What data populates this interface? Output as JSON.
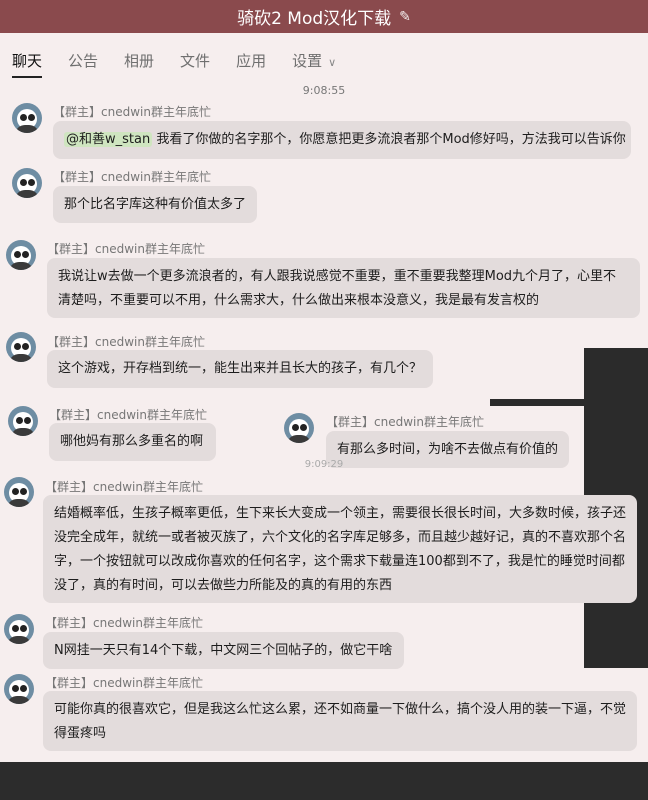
{
  "window": {
    "title": "骑砍2 Mod汉化下载",
    "edit_icon": "✎"
  },
  "tabs": [
    {
      "label": "聊天"
    },
    {
      "label": "公告"
    },
    {
      "label": "相册"
    },
    {
      "label": "文件"
    },
    {
      "label": "应用"
    },
    {
      "label": "设置"
    }
  ],
  "timestamps": {
    "t1": "9:08:55",
    "t2": "9:09:29"
  },
  "messages": [
    {
      "sender": "【群主】cnedwin群主年底忙",
      "mention": "@和善w_stan",
      "text": "我看了你做的名字那个，你愿意把更多流浪者那个Mod修好吗，方法我可以告诉你"
    },
    {
      "sender": "【群主】cnedwin群主年底忙",
      "text": "那个比名字库这种有价值太多了"
    },
    {
      "sender": "【群主】cnedwin群主年底忙",
      "text": "我说让w去做一个更多流浪者的，有人跟我说感觉不重要，重不重要我整理Mod九个月了，心里不清楚吗，不重要可以不用，什么需求大，什么做出来根本没意义，我是最有发言权的"
    },
    {
      "sender": "【群主】cnedwin群主年底忙",
      "text": "这个游戏，开存档到统一，能生出来并且长大的孩子，有几个？"
    },
    {
      "sender": "【群主】cnedwin群主年底忙",
      "text": "哪他妈有那么多重名的啊"
    },
    {
      "sender": "【群主】cnedwin群主年底忙",
      "text": "有那么多时间，为啥不去做点有价值的"
    },
    {
      "sender": "【群主】cnedwin群主年底忙",
      "text": "结婚概率低，生孩子概率更低，生下来长大变成一个领主，需要很长很长时间，大多数时候，孩子还没完全成年，就统一或者被灭族了，六个文化的名字库足够多，而且越少越好记，真的不喜欢那个名字，一个按钮就可以改成你喜欢的任何名字，这个需求下载量连100都到不了，我是忙的睡觉时间都没了，真的有时间，可以去做些力所能及的真的有用的东西"
    },
    {
      "sender": "【群主】cnedwin群主年底忙",
      "text": "N网挂一天只有14个下载，中文网三个回帖子的，做它干啥"
    },
    {
      "sender": "【群主】cnedwin群主年底忙",
      "text": "可能你真的很喜欢它，但是我这么忙这么累，还不如商量一下做什么，搞个没人用的装一下逼，不觉得蛋疼吗"
    }
  ]
}
